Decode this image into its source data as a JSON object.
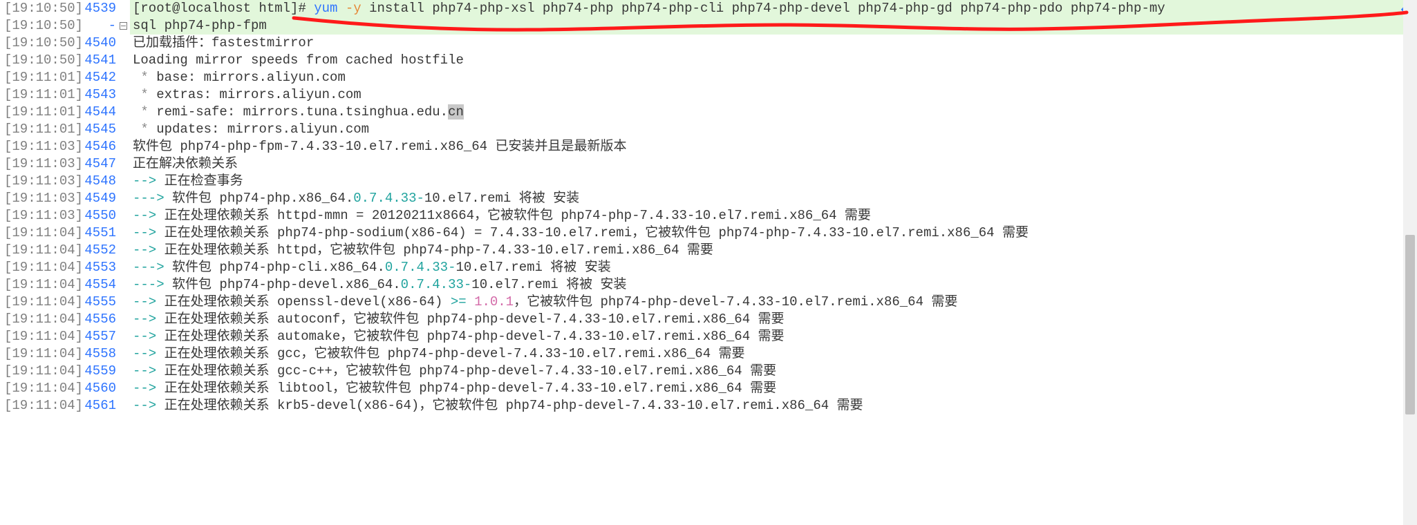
{
  "wrap_glyph": "↵",
  "collapse_marker_row": 1,
  "rows": [
    {
      "ts": "[19:10:50]",
      "ln": "4539",
      "hl": true,
      "segments": [
        {
          "t": "[root@localhost html]# ",
          "cls": "cmd-prompt"
        },
        {
          "t": "yum ",
          "cls": "cmd-yum"
        },
        {
          "t": "-y ",
          "cls": "cmd-flag"
        },
        {
          "t": "install php74-php-xsl php74-php php74-php-cli php74-php-devel php74-php-gd php74-php-pdo php74-php-my",
          "cls": ""
        }
      ],
      "wrap": true
    },
    {
      "ts": "[19:10:50]",
      "ln": "-",
      "hl": true,
      "segments": [
        {
          "t": "sql php74-php-fpm",
          "cls": ""
        }
      ]
    },
    {
      "ts": "[19:10:50]",
      "ln": "4540",
      "segments": [
        {
          "t": "已加载插件：fastestmirror",
          "cls": ""
        }
      ]
    },
    {
      "ts": "[19:10:50]",
      "ln": "4541",
      "segments": [
        {
          "t": "Loading mirror speeds from cached hostfile",
          "cls": ""
        }
      ]
    },
    {
      "ts": "[19:11:01]",
      "ln": "4542",
      "segments": [
        {
          "t": " * ",
          "cls": "grey-star"
        },
        {
          "t": "base: mirrors.aliyun.com",
          "cls": ""
        }
      ]
    },
    {
      "ts": "[19:11:01]",
      "ln": "4543",
      "segments": [
        {
          "t": " * ",
          "cls": "grey-star"
        },
        {
          "t": "extras: mirrors.aliyun.com",
          "cls": ""
        }
      ]
    },
    {
      "ts": "[19:11:01]",
      "ln": "4544",
      "segments": [
        {
          "t": " * ",
          "cls": "grey-star"
        },
        {
          "t": "remi-safe: mirrors.tuna.tsinghua.edu.",
          "cls": ""
        },
        {
          "t": "cn",
          "cls": "sel-cn"
        }
      ]
    },
    {
      "ts": "[19:11:01]",
      "ln": "4545",
      "segments": [
        {
          "t": " * ",
          "cls": "grey-star"
        },
        {
          "t": "updates: mirrors.aliyun.com",
          "cls": ""
        }
      ]
    },
    {
      "ts": "[19:11:03]",
      "ln": "4546",
      "segments": [
        {
          "t": "软件包 php74-php-fpm-7.4.33-10.el7.remi.x86_64 已安装并且是最新版本",
          "cls": ""
        }
      ]
    },
    {
      "ts": "[19:11:03]",
      "ln": "4547",
      "segments": [
        {
          "t": "正在解决依赖关系",
          "cls": ""
        }
      ]
    },
    {
      "ts": "[19:11:03]",
      "ln": "4548",
      "segments": [
        {
          "t": "--> ",
          "cls": "arrow"
        },
        {
          "t": "正在检查事务",
          "cls": ""
        }
      ]
    },
    {
      "ts": "[19:11:03]",
      "ln": "4549",
      "segments": [
        {
          "t": "---> ",
          "cls": "arrow"
        },
        {
          "t": "软件包 php74-php.x86_64.",
          "cls": ""
        },
        {
          "t": "0.7.4.33-",
          "cls": "teal"
        },
        {
          "t": "10.el7.remi 将被 安装",
          "cls": ""
        }
      ]
    },
    {
      "ts": "[19:11:03]",
      "ln": "4550",
      "segments": [
        {
          "t": "--> ",
          "cls": "arrow"
        },
        {
          "t": "正在处理依赖关系 httpd-mmn = 20120211x8664，它被软件包 php74-php-7.4.33-10.el7.remi.x86_64 需要",
          "cls": ""
        }
      ]
    },
    {
      "ts": "[19:11:04]",
      "ln": "4551",
      "segments": [
        {
          "t": "--> ",
          "cls": "arrow"
        },
        {
          "t": "正在处理依赖关系 php74-php-sodium(x86-64) = 7.4.33-10.el7.remi，它被软件包 php74-php-7.4.33-10.el7.remi.x86_64 需要",
          "cls": ""
        }
      ]
    },
    {
      "ts": "[19:11:04]",
      "ln": "4552",
      "segments": [
        {
          "t": "--> ",
          "cls": "arrow"
        },
        {
          "t": "正在处理依赖关系 httpd，它被软件包 php74-php-7.4.33-10.el7.remi.x86_64 需要",
          "cls": ""
        }
      ]
    },
    {
      "ts": "[19:11:04]",
      "ln": "4553",
      "segments": [
        {
          "t": "---> ",
          "cls": "arrow"
        },
        {
          "t": "软件包 php74-php-cli.x86_64.",
          "cls": ""
        },
        {
          "t": "0.7.4.33-",
          "cls": "teal"
        },
        {
          "t": "10.el7.remi 将被 安装",
          "cls": ""
        }
      ]
    },
    {
      "ts": "[19:11:04]",
      "ln": "4554",
      "segments": [
        {
          "t": "---> ",
          "cls": "arrow"
        },
        {
          "t": "软件包 php74-php-devel.x86_64.",
          "cls": ""
        },
        {
          "t": "0.7.4.33-",
          "cls": "teal"
        },
        {
          "t": "10.el7.remi 将被 安装",
          "cls": ""
        }
      ]
    },
    {
      "ts": "[19:11:04]",
      "ln": "4555",
      "segments": [
        {
          "t": "--> ",
          "cls": "arrow"
        },
        {
          "t": "正在处理依赖关系 openssl-devel(x86-64) ",
          "cls": ""
        },
        {
          "t": ">= ",
          "cls": "teal"
        },
        {
          "t": "1.0.1",
          "cls": "pink"
        },
        {
          "t": "，它被软件包 php74-php-devel-7.4.33-10.el7.remi.x86_64 需要",
          "cls": ""
        }
      ]
    },
    {
      "ts": "[19:11:04]",
      "ln": "4556",
      "segments": [
        {
          "t": "--> ",
          "cls": "arrow"
        },
        {
          "t": "正在处理依赖关系 autoconf，它被软件包 php74-php-devel-7.4.33-10.el7.remi.x86_64 需要",
          "cls": ""
        }
      ]
    },
    {
      "ts": "[19:11:04]",
      "ln": "4557",
      "segments": [
        {
          "t": "--> ",
          "cls": "arrow"
        },
        {
          "t": "正在处理依赖关系 automake，它被软件包 php74-php-devel-7.4.33-10.el7.remi.x86_64 需要",
          "cls": ""
        }
      ]
    },
    {
      "ts": "[19:11:04]",
      "ln": "4558",
      "segments": [
        {
          "t": "--> ",
          "cls": "arrow"
        },
        {
          "t": "正在处理依赖关系 gcc，它被软件包 php74-php-devel-7.4.33-10.el7.remi.x86_64 需要",
          "cls": ""
        }
      ]
    },
    {
      "ts": "[19:11:04]",
      "ln": "4559",
      "segments": [
        {
          "t": "--> ",
          "cls": "arrow"
        },
        {
          "t": "正在处理依赖关系 gcc-c++，它被软件包 php74-php-devel-7.4.33-10.el7.remi.x86_64 需要",
          "cls": ""
        }
      ]
    },
    {
      "ts": "[19:11:04]",
      "ln": "4560",
      "segments": [
        {
          "t": "--> ",
          "cls": "arrow"
        },
        {
          "t": "正在处理依赖关系 libtool，它被软件包 php74-php-devel-7.4.33-10.el7.remi.x86_64 需要",
          "cls": ""
        }
      ]
    },
    {
      "ts": "[19:11:04]",
      "ln": "4561",
      "segments": [
        {
          "t": "--> ",
          "cls": "arrow"
        },
        {
          "t": "正在处理依赖关系 krb5-devel(x86-64)，它被软件包 php74-php-devel-7.4.33-10.el7.remi.x86_64 需要",
          "cls": ""
        }
      ]
    }
  ]
}
